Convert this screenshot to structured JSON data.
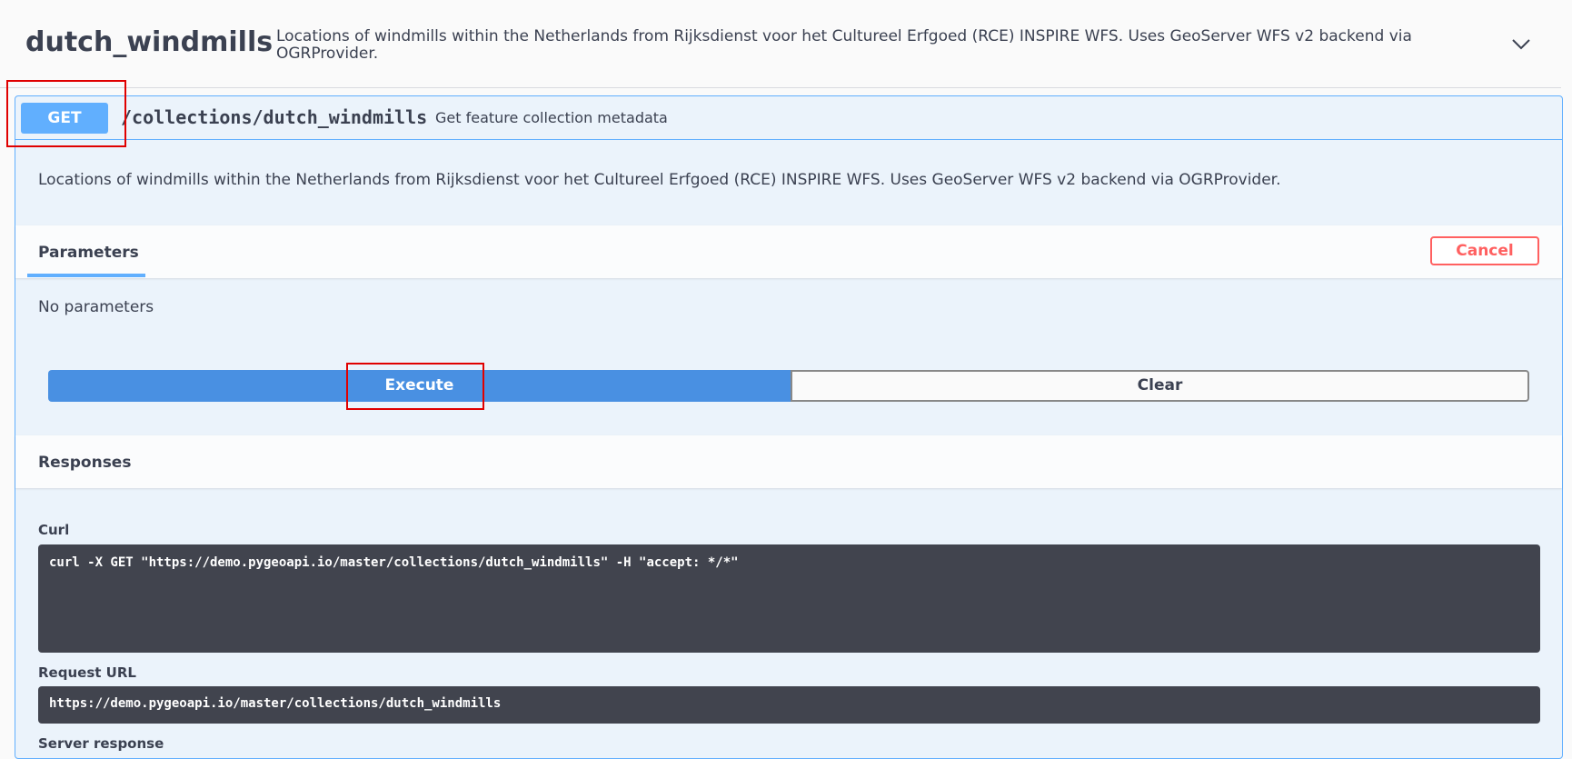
{
  "tag": {
    "title": "dutch_windmills",
    "description": "Locations of windmills within the Netherlands from Rijksdienst voor het Cultureel Erfgoed (RCE) INSPIRE WFS. Uses GeoServer WFS v2 backend via OGRProvider."
  },
  "operation": {
    "method": "GET",
    "path": "/collections/dutch_windmills",
    "summary": "Get feature collection metadata",
    "description": "Locations of windmills within the Netherlands from Rijksdienst voor het Cultureel Erfgoed (RCE) INSPIRE WFS. Uses GeoServer WFS v2 backend via OGRProvider."
  },
  "parameters": {
    "tab_label": "Parameters",
    "cancel_label": "Cancel",
    "empty_text": "No parameters"
  },
  "actions": {
    "execute_label": "Execute",
    "clear_label": "Clear"
  },
  "responses": {
    "title": "Responses",
    "curl_label": "Curl",
    "curl_command": "curl -X GET \"https://demo.pygeoapi.io/master/collections/dutch_windmills\" -H \"accept: */*\"",
    "request_url_label": "Request URL",
    "request_url": "https://demo.pygeoapi.io/master/collections/dutch_windmills",
    "server_response_label": "Server response"
  },
  "colors": {
    "get_accent": "#61affe",
    "execute_blue": "#4990e2",
    "cancel_red": "#ff6060",
    "code_bg": "#41444e",
    "highlight_red": "#e00000"
  }
}
